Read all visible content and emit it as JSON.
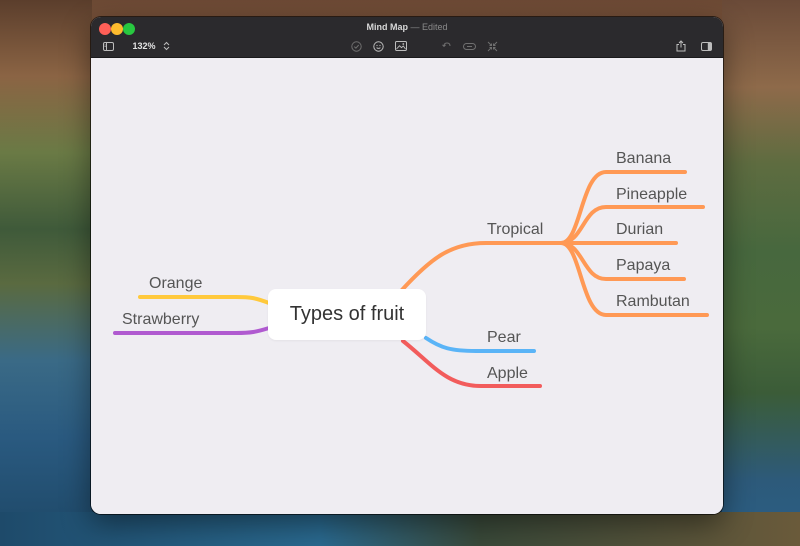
{
  "window": {
    "title": "Mind Map",
    "separator": "—",
    "status": "Edited"
  },
  "toolbar": {
    "zoom": "132%",
    "icons": [
      "sidebar-icon",
      "zoom-stepper-icon",
      "checkmark-icon",
      "smiley-icon",
      "image-icon",
      "undo-icon",
      "link-icon",
      "collapse-icon",
      "share-icon",
      "inspector-icon"
    ]
  },
  "mindmap": {
    "central": "Types of fruit",
    "branches": {
      "tropical": {
        "label": "Tropical",
        "color": "#ff9955",
        "children": [
          "Banana",
          "Pineapple",
          "Durian",
          "Papaya",
          "Rambutan"
        ]
      },
      "pear": {
        "label": "Pear",
        "color": "#5ab4f7"
      },
      "apple": {
        "label": "Apple",
        "color": "#f25c5c"
      },
      "orange": {
        "label": "Orange",
        "color": "#ffc93c"
      },
      "strawberry": {
        "label": "Strawberry",
        "color": "#b05ad0"
      }
    }
  }
}
